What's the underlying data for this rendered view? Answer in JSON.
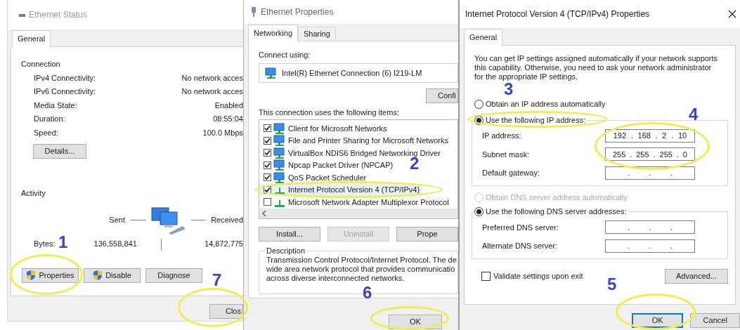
{
  "ethernet_status": {
    "title": "Ethernet Status",
    "tabs": [
      {
        "label": "General",
        "selected": true
      }
    ],
    "connection_heading": "Connection",
    "connection_rows": [
      {
        "label": "IPv4 Connectivity:",
        "value": "No network acces"
      },
      {
        "label": "IPv6 Connectivity:",
        "value": "No network acces"
      },
      {
        "label": "Media State:",
        "value": "Enabled"
      },
      {
        "label": "Duration:",
        "value": "08:55:04"
      },
      {
        "label": "Speed:",
        "value": "100.0 Mbps"
      }
    ],
    "details_button": "Details...",
    "activity_heading": "Activity",
    "sent_label": "Sent",
    "received_label": "Received",
    "bytes_label": "Bytes:",
    "bytes_sent": "136,558,841",
    "bytes_received": "14,872,775",
    "buttons": [
      {
        "label": "Properties",
        "kind": "shield"
      },
      {
        "label": "Disable",
        "kind": "shield"
      },
      {
        "label": "Diagnose",
        "kind": "plain"
      }
    ],
    "close_button": "Clos"
  },
  "ethernet_properties": {
    "title": "Ethernet Properties",
    "tabs": [
      {
        "label": "Networking",
        "selected": true
      },
      {
        "label": "Sharing",
        "selected": false
      }
    ],
    "connect_using_label": "Connect using:",
    "adapter": "Intel(R) Ethernet Connection (6) I219-LM",
    "configure_button": "Confi",
    "items_label": "This connection uses the following items:",
    "items": [
      {
        "label": "Client for Microsoft Networks",
        "checked": true,
        "selected": false,
        "kind": "monitor"
      },
      {
        "label": "File and Printer Sharing for Microsoft Networks",
        "checked": true,
        "selected": false,
        "kind": "monitor"
      },
      {
        "label": "VirtualBox NDIS6 Bridged Networking Driver",
        "checked": true,
        "selected": false,
        "kind": "monitor"
      },
      {
        "label": "Npcap Packet Driver (NPCAP)",
        "checked": true,
        "selected": false,
        "kind": "monitor"
      },
      {
        "label": "QoS Packet Scheduler",
        "checked": true,
        "selected": false,
        "kind": "monitor"
      },
      {
        "label": "Internet Protocol Version 4 (TCP/IPv4)",
        "checked": true,
        "selected": true,
        "kind": "protocol"
      },
      {
        "label": "Microsoft Network Adapter Multiplexor Protocol",
        "checked": false,
        "selected": false,
        "kind": "protocol"
      }
    ],
    "buttons": [
      {
        "label": "Install...",
        "disabled": false
      },
      {
        "label": "Uninstall",
        "disabled": true
      },
      {
        "label": "Prope",
        "disabled": false
      }
    ],
    "description": {
      "heading": "Description",
      "lines": [
        "Transmission Control Protocol/Internet Protocol. The de",
        "wide area network protocol that provides communicatio",
        "across diverse interconnected networks."
      ]
    },
    "ok_button": "OK"
  },
  "ipv4_properties": {
    "title": "Internet Protocol Version 4 (TCP/IPv4) Properties",
    "tabs": [
      {
        "label": "General",
        "selected": true
      }
    ],
    "intro_lines": [
      "You can get IP settings assigned automatically if your network supports",
      "this capability. Otherwise, you need to ask your network administrator",
      "for the appropriate IP settings."
    ],
    "ip_mode": [
      {
        "label": "Obtain an IP address automatically",
        "selected": false,
        "disabled": false
      },
      {
        "label": "Use the following IP address:",
        "selected": true,
        "disabled": false
      }
    ],
    "ip_fields": [
      {
        "label": "IP address:",
        "parts": [
          "192",
          ".",
          "168",
          ".",
          "2",
          ".",
          "10"
        ]
      },
      {
        "label": "Subnet mask:",
        "parts": [
          "255",
          ".",
          "255",
          ".",
          "255",
          ".",
          "0"
        ]
      },
      {
        "label": "Default gateway:",
        "parts": [
          ".",
          ".",
          "."
        ]
      }
    ],
    "dns_mode": [
      {
        "label": "Obtain DNS server address automatically",
        "selected": false,
        "disabled": true
      },
      {
        "label": "Use the following DNS server addresses:",
        "selected": true,
        "disabled": false
      }
    ],
    "dns_fields": [
      {
        "label": "Preferred DNS server:",
        "parts": [
          ".",
          ".",
          "."
        ]
      },
      {
        "label": "Alternate DNS server:",
        "parts": [
          ".",
          ".",
          "."
        ]
      }
    ],
    "validate": {
      "label": "Validate settings upon exit",
      "checked": false
    },
    "advanced_button": "Advanced...",
    "ok_button": "OK",
    "cancel_button": "Cancel"
  },
  "annotations": [
    {
      "label": "1"
    },
    {
      "label": "2"
    },
    {
      "label": "3"
    },
    {
      "label": "4"
    },
    {
      "label": "5"
    },
    {
      "label": "6"
    },
    {
      "label": "7"
    }
  ]
}
